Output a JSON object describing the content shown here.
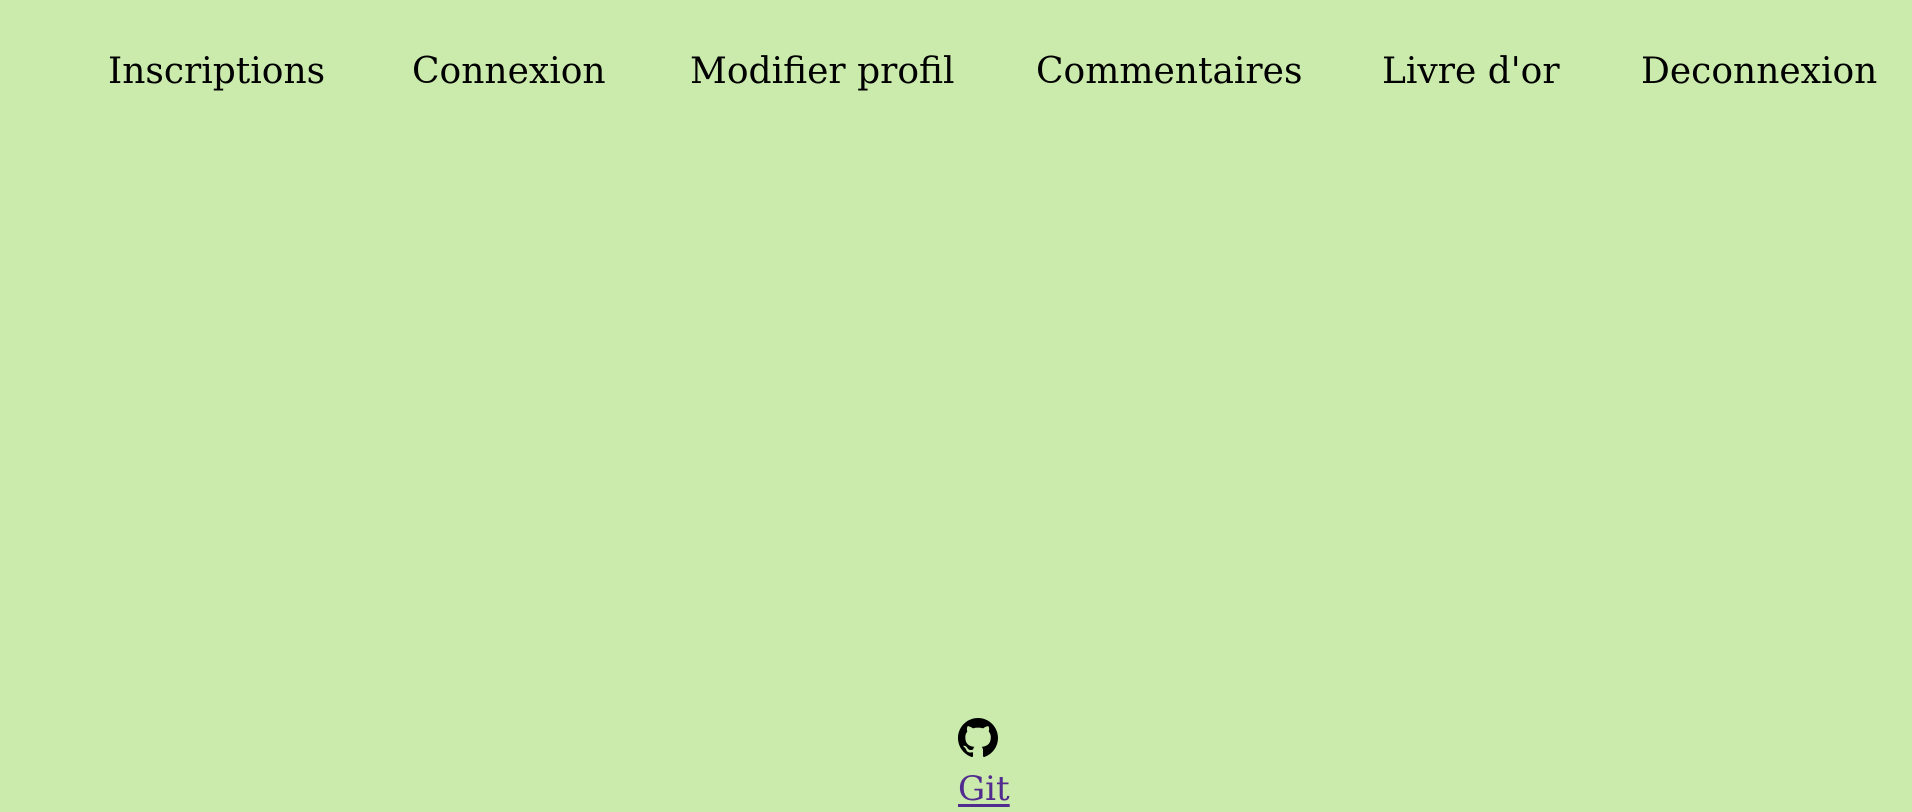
{
  "nav": {
    "items": [
      {
        "label": "Inscriptions"
      },
      {
        "label": "Connexion"
      },
      {
        "label": "Modifier profil"
      },
      {
        "label": "Commentaires"
      },
      {
        "label": "Livre d'or"
      },
      {
        "label": "Deconnexion"
      }
    ]
  },
  "footer": {
    "icon": "github-icon",
    "link_label": "Git"
  },
  "colors": {
    "background": "#cbebad",
    "text": "#000000",
    "link_visited": "#522b8f"
  }
}
